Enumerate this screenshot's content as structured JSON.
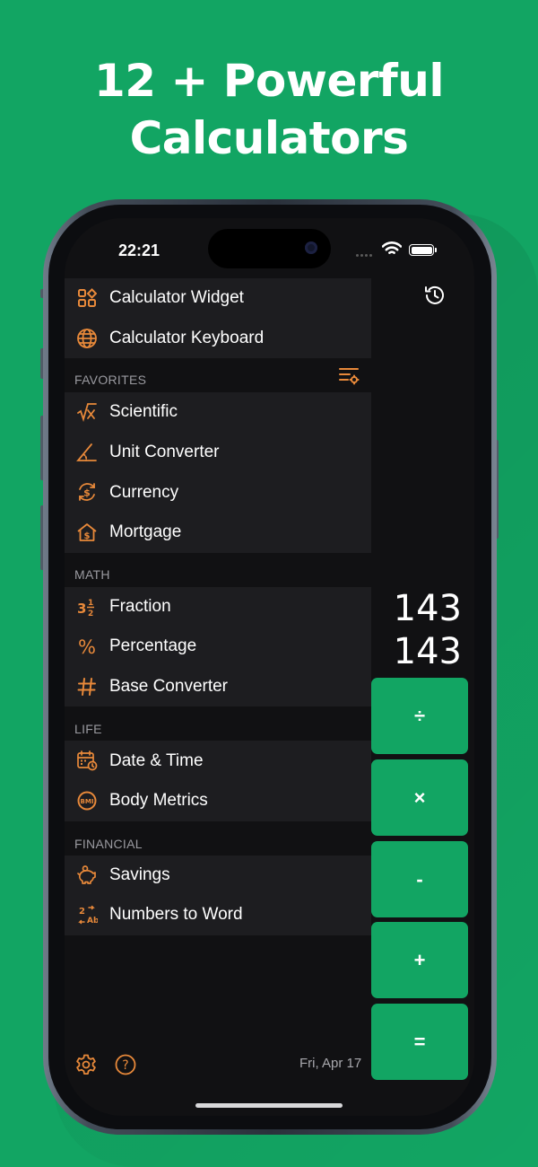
{
  "headline": {
    "line1": "12 + Powerful",
    "line2": "Calculators"
  },
  "status_bar": {
    "time": "22:21"
  },
  "menu": {
    "top_items": [
      {
        "icon": "widget-icon",
        "label": "Calculator Widget"
      },
      {
        "icon": "globe-icon",
        "label": "Calculator Keyboard"
      }
    ],
    "sections": [
      {
        "title": "FAVORITES",
        "items": [
          {
            "icon": "sqrt-x-icon",
            "label": "Scientific"
          },
          {
            "icon": "angle-icon",
            "label": "Unit Converter"
          },
          {
            "icon": "currency-exchange-icon",
            "label": "Currency"
          },
          {
            "icon": "house-dollar-icon",
            "label": "Mortgage"
          }
        ]
      },
      {
        "title": "MATH",
        "items": [
          {
            "icon": "fraction-icon",
            "label": "Fraction"
          },
          {
            "icon": "percent-icon",
            "label": "Percentage"
          },
          {
            "icon": "hash-icon",
            "label": "Base Converter"
          }
        ]
      },
      {
        "title": "LIFE",
        "items": [
          {
            "icon": "calendar-clock-icon",
            "label": "Date & Time"
          },
          {
            "icon": "bmi-icon",
            "label": "Body Metrics"
          }
        ]
      },
      {
        "title": "FINANCIAL",
        "items": [
          {
            "icon": "piggy-bank-icon",
            "label": "Savings"
          },
          {
            "icon": "numbers-to-word-icon",
            "label": "Numbers to Word"
          }
        ]
      }
    ]
  },
  "calculator": {
    "display_expression": "143",
    "display_result": "143",
    "operators": [
      "÷",
      "×",
      "-",
      "+",
      "="
    ]
  },
  "footer": {
    "date": "Fri, Apr 17"
  },
  "colors": {
    "background": "#12a563",
    "accent_icon": "#e8893a",
    "panel": "#1d1d20",
    "screen": "#111113"
  }
}
